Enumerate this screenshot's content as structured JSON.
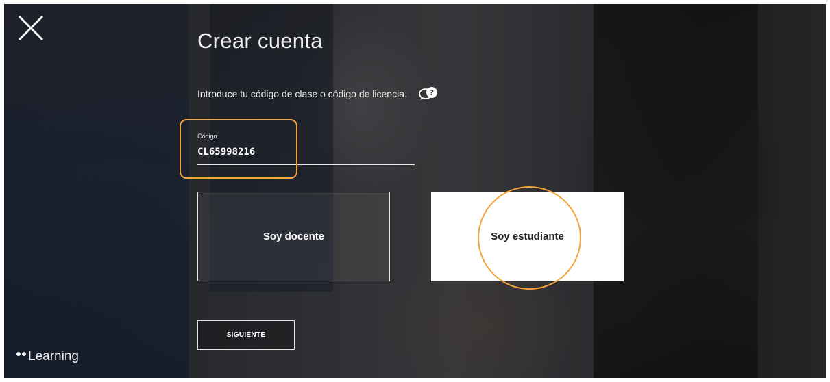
{
  "page": {
    "title": "Crear cuenta",
    "instruction": "Introduce tu código de clase o código de licencia."
  },
  "code_field": {
    "label": "Código",
    "value": "CL65998216"
  },
  "role_options": {
    "teacher_label": "Soy docente",
    "student_label": "Soy estudiante",
    "selected": "student"
  },
  "actions": {
    "next_label": "SIGUIENTE"
  },
  "brand": {
    "name": "Learning"
  },
  "colors": {
    "highlight": "#f2a33a",
    "overlay": "#2b2d33",
    "selected_option_bg": "#ffffff"
  },
  "icons": {
    "close": "close-icon",
    "help": "chat-help-icon",
    "logo_dots": "logo-dots-icon"
  }
}
